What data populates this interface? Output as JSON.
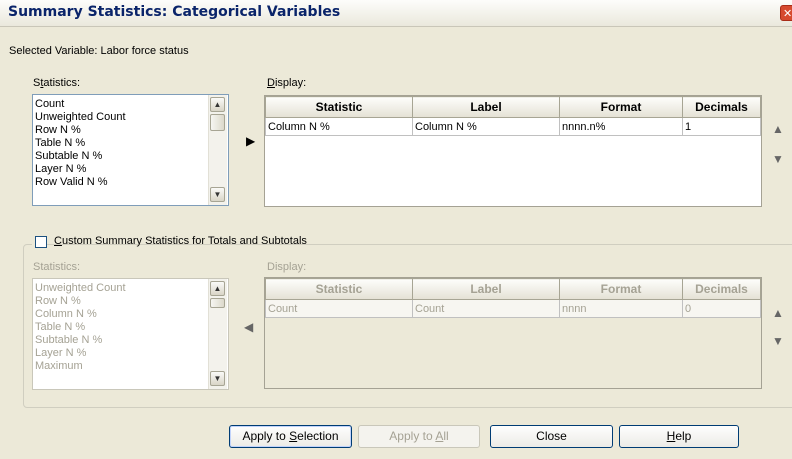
{
  "window": {
    "title": "Summary Statistics: Categorical Variables",
    "close_glyph": "✕"
  },
  "selected_variable": "Selected Variable: Labor force status",
  "top": {
    "statistics_label": "Statistics:",
    "statistics_items": [
      "Count",
      "Unweighted Count",
      "Row N %",
      "Table N %",
      "Subtable N %",
      "Layer N %",
      "Row Valid N %"
    ],
    "display_label": "Display:",
    "columns": [
      "Statistic",
      "Label",
      "Format",
      "Decimals"
    ],
    "rows": [
      {
        "statistic": "Column N %",
        "label": "Column N %",
        "format": "nnnn.n%",
        "decimals": "1"
      }
    ]
  },
  "custom": {
    "checkbox_label": "Custom Summary Statistics for Totals and Subtotals",
    "checked": false,
    "statistics_label": "Statistics:",
    "statistics_items": [
      "Unweighted Count",
      "Row N %",
      "Column N %",
      "Table N %",
      "Subtable N %",
      "Layer N %",
      "Maximum"
    ],
    "display_label": "Display:",
    "columns": [
      "Statistic",
      "Label",
      "Format",
      "Decimals"
    ],
    "rows": [
      {
        "statistic": "Count",
        "label": "Count",
        "format": "nnnn",
        "decimals": "0"
      }
    ]
  },
  "buttons": {
    "apply_selection": "Apply to Selection",
    "apply_all": "Apply to All",
    "close": "Close",
    "help": "Help"
  },
  "icons": {
    "move_right": "right-triangle-icon",
    "move_left": "left-triangle-icon",
    "move_up": "up-triangle-icon",
    "move_down": "down-triangle-icon"
  }
}
